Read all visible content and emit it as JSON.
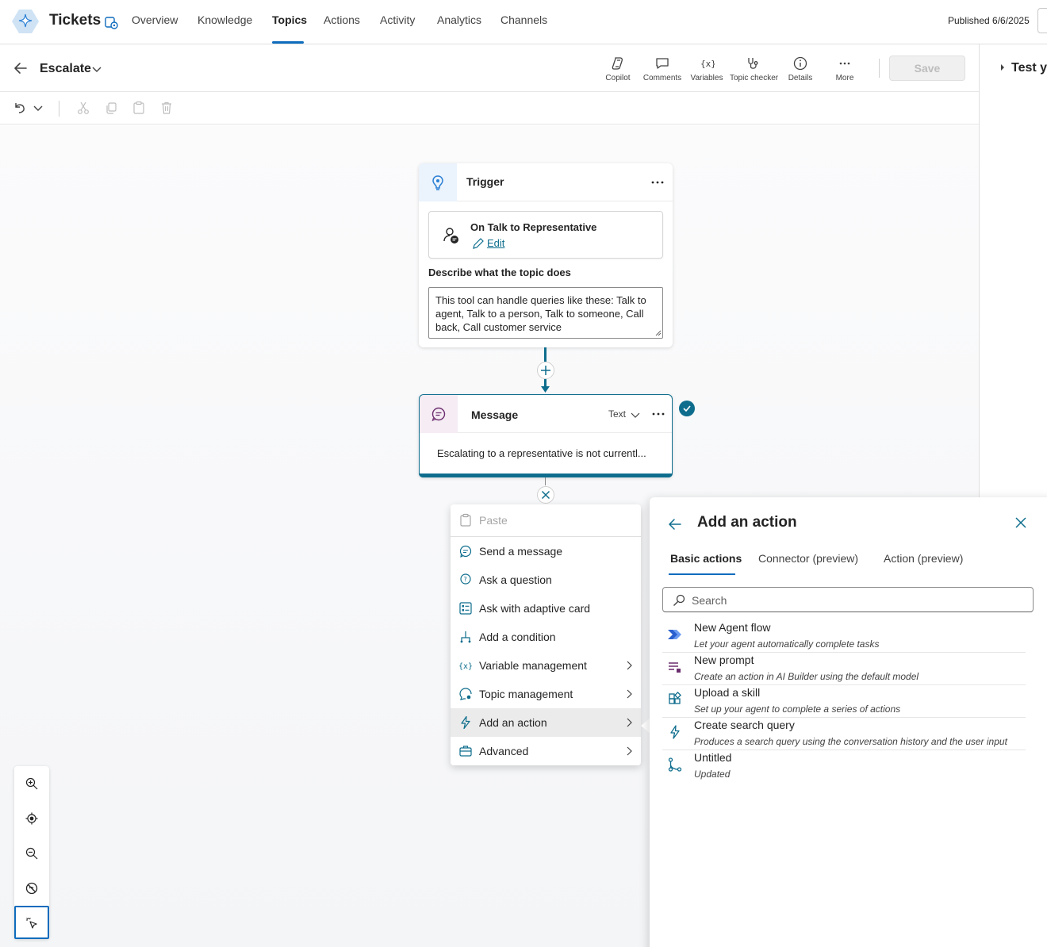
{
  "app": {
    "title": "Tickets",
    "published": "Published 6/6/2025",
    "tabs": [
      "Overview",
      "Knowledge",
      "Topics",
      "Actions",
      "Activity",
      "Analytics",
      "Channels"
    ],
    "active_tab": "Topics"
  },
  "topic": {
    "name": "Escalate"
  },
  "toolbar": {
    "tools": [
      "Copilot",
      "Comments",
      "Variables",
      "Topic checker",
      "Details",
      "More"
    ],
    "save_label": "Save"
  },
  "test_panel": {
    "title": "Test yo"
  },
  "trigger_node": {
    "title": "Trigger",
    "trigger_name": "On Talk to Representative",
    "edit_label": "Edit",
    "desc_label": "Describe what the topic does",
    "desc_text": "This tool can handle queries like these: Talk to agent, Talk to a person, Talk to someone, Call back, Call customer service"
  },
  "message_node": {
    "title": "Message",
    "type_label": "Text",
    "body": "Escalating to a representative is not currentl..."
  },
  "context_menu": {
    "paste": "Paste",
    "items": [
      {
        "label": "Send a message",
        "icon": "message-icon"
      },
      {
        "label": "Ask a question",
        "icon": "question-icon"
      },
      {
        "label": "Ask with adaptive card",
        "icon": "adaptive-card-icon"
      },
      {
        "label": "Add a condition",
        "icon": "branch-icon"
      },
      {
        "label": "Variable management",
        "icon": "variable-icon"
      },
      {
        "label": "Topic management",
        "icon": "topic-icon"
      },
      {
        "label": "Add an action",
        "icon": "lightning-icon"
      },
      {
        "label": "Advanced",
        "icon": "briefcase-icon"
      }
    ]
  },
  "action_panel": {
    "title": "Add an action",
    "tabs": [
      "Basic actions",
      "Connector (preview)",
      "Action (preview)"
    ],
    "search_placeholder": "Search",
    "items": [
      {
        "title": "New Agent flow",
        "subtitle": "Let your agent automatically complete tasks"
      },
      {
        "title": "New prompt",
        "subtitle": "Create an action in AI Builder using the default model"
      },
      {
        "title": "Upload a skill",
        "subtitle": "Set up your agent to complete a series of actions"
      },
      {
        "title": "Create search query",
        "subtitle": "Produces a search query using the conversation history and the user input"
      },
      {
        "title": "Untitled",
        "subtitle": "Updated"
      }
    ]
  },
  "colors": {
    "accent": "#0f6cbd",
    "connector": "#0e6d8d",
    "message_purple": "#6b2d6e"
  }
}
